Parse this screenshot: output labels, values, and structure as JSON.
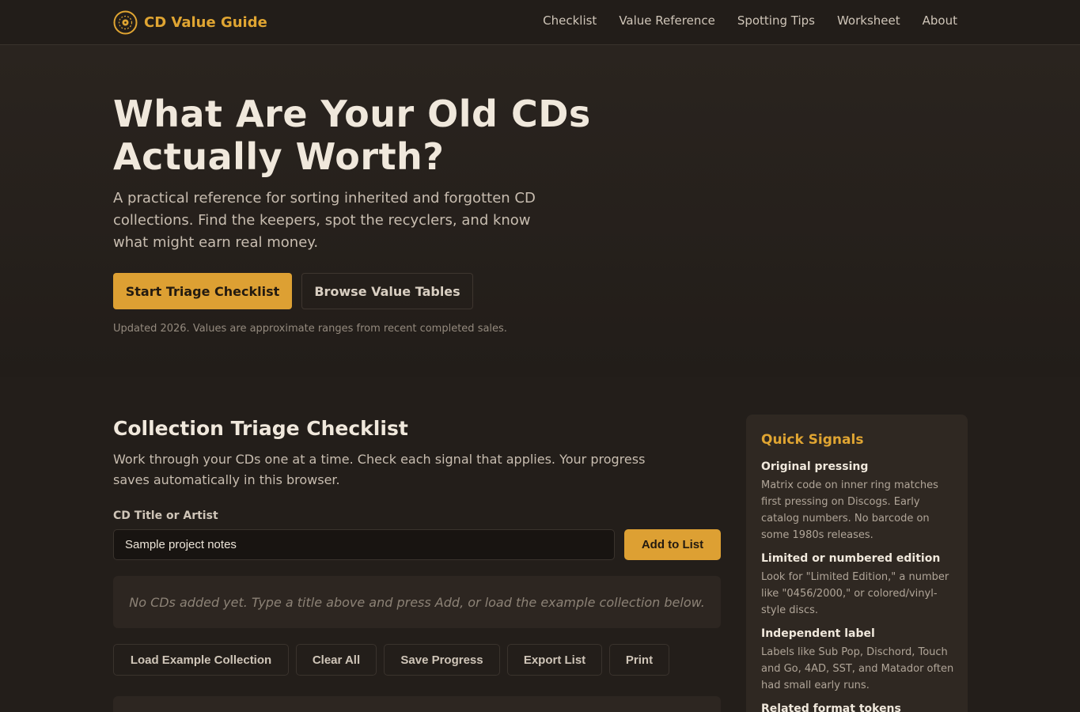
{
  "brand": {
    "name": "CD Value Guide",
    "color": "#e0a532",
    "icon": "disc-icon"
  },
  "nav": [
    {
      "label": "Checklist"
    },
    {
      "label": "Value Reference"
    },
    {
      "label": "Spotting Tips"
    },
    {
      "label": "Worksheet"
    },
    {
      "label": "About"
    }
  ],
  "hero": {
    "title": "What Are Your Old CDs Actually Worth?",
    "subtitle": "A practical reference for sorting inherited and forgotten CD collections. Find the keepers, spot the recyclers, and know what might earn real money.",
    "primary_button": "Start Triage Checklist",
    "secondary_button": "Browse Value Tables",
    "note": "Updated 2026. Values are approximate ranges from recent completed sales."
  },
  "checklist": {
    "title": "Collection Triage Checklist",
    "description": "Work through your CDs one at a time. Check each signal that applies. Your progress saves automatically in this browser.",
    "field_label": "CD Title or Artist",
    "input_value": "Sample project notes",
    "add_button": "Add to List",
    "empty_message": "No CDs added yet. Type a title above and press Add, or load the example collection below.",
    "actions": {
      "load_example": "Load Example Collection",
      "clear_all": "Clear All",
      "save_progress": "Save Progress",
      "export_list": "Export List",
      "print": "Print"
    }
  },
  "sidebar": {
    "title": "Quick Signals",
    "signals": [
      {
        "name": "Original pressing",
        "desc": "Matrix code on inner ring matches first pressing on Discogs. Early catalog numbers. No barcode on some 1980s releases."
      },
      {
        "name": "Limited or numbered edition",
        "desc": "Look for \"Limited Edition,\" a number like \"0456/2000,\" or colored/vinyl-style discs."
      },
      {
        "name": "Independent label",
        "desc": "Labels like Sub Pop, Dischord, Touch and Go, 4AD, SST, and Matador often had small early runs."
      },
      {
        "name": "Related format tokens",
        "desc": ""
      }
    ]
  },
  "colors": {
    "accent": "#dda033",
    "background": "#231e1a",
    "panel": "#2f2822"
  }
}
